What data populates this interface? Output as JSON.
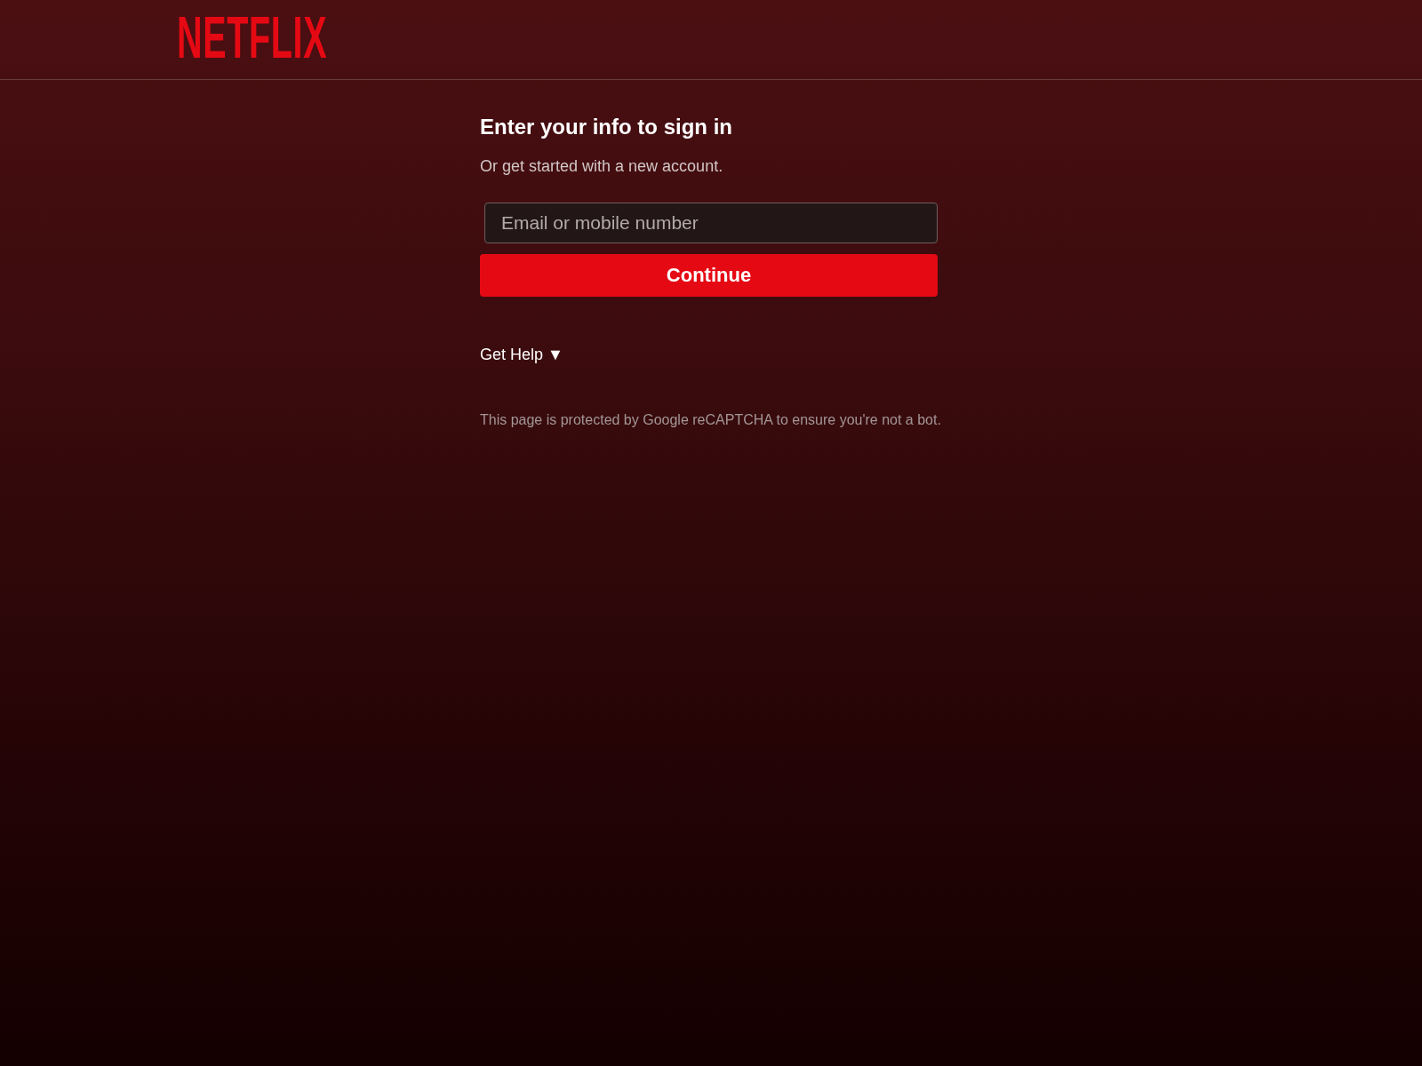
{
  "logo": {
    "text": "NETFLIX"
  },
  "signin": {
    "heading": "Enter your info to sign in",
    "subtitle": "Or get started with a new account.",
    "email_field": {
      "placeholder": "Email or mobile number"
    },
    "continue_button": "Continue",
    "help_link": "Get Help ▼"
  },
  "recaptcha_notice": "This page is protected by Google reCAPTCHA to ensure you're not a bot."
}
